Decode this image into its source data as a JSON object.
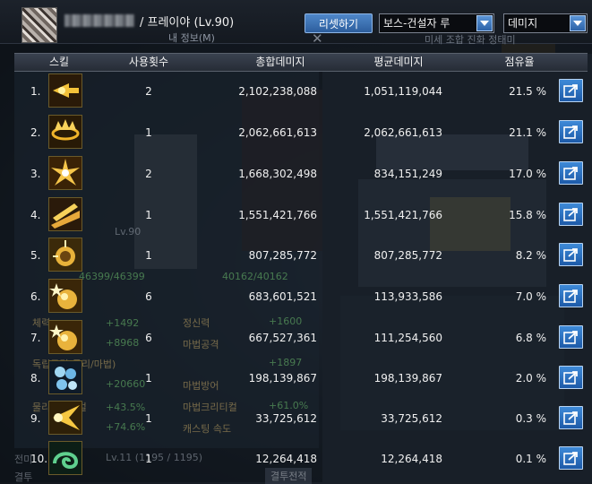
{
  "header": {
    "character_info": "/ 프레이야 (Lv.90)",
    "sub_label": "내 정보(M)",
    "bg_text_right": "미세 조합 진화 정태미",
    "reset_button": "리셋하기",
    "boss_select": "보스-건설자 루",
    "metric_select": "데미지"
  },
  "table": {
    "headers": {
      "skill": "스킬",
      "uses": "사용횟수",
      "total": "총합데미지",
      "avg": "평균데미지",
      "share": "점유율"
    },
    "rows": [
      {
        "rank": "1.",
        "icon": "arrow-skill-icon",
        "uses": "2",
        "total": "2,102,238,088",
        "avg": "1,051,119,044",
        "share": "21.5 %"
      },
      {
        "rank": "2.",
        "icon": "crown-ring-skill-icon",
        "uses": "1",
        "total": "2,062,661,613",
        "avg": "2,062,661,613",
        "share": "21.1 %"
      },
      {
        "rank": "3.",
        "icon": "burst-skill-icon",
        "uses": "2",
        "total": "1,668,302,498",
        "avg": "834,151,249",
        "share": "17.0 %"
      },
      {
        "rank": "4.",
        "icon": "ground-slash-skill-icon",
        "uses": "1",
        "total": "1,551,421,766",
        "avg": "1,551,421,766",
        "share": "15.8 %"
      },
      {
        "rank": "5.",
        "icon": "target-bomb-skill-icon",
        "uses": "1",
        "total": "807,285,772",
        "avg": "807,285,772",
        "share": "8.2 %"
      },
      {
        "rank": "6.",
        "icon": "spark-bomb-skill-icon",
        "uses": "6",
        "total": "683,601,521",
        "avg": "113,933,586",
        "share": "7.0 %"
      },
      {
        "rank": "7.",
        "icon": "spark-bomb-skill-icon",
        "uses": "6",
        "total": "667,527,361",
        "avg": "111,254,560",
        "share": "6.8 %"
      },
      {
        "rank": "8.",
        "icon": "ice-cluster-skill-icon",
        "uses": "1",
        "total": "198,139,867",
        "avg": "198,139,867",
        "share": "2.0 %"
      },
      {
        "rank": "9.",
        "icon": "light-burst-skill-icon",
        "uses": "1",
        "total": "33,725,612",
        "avg": "33,725,612",
        "share": "0.3 %"
      },
      {
        "rank": "10.",
        "icon": "green-spiral-skill-icon",
        "uses": "1",
        "total": "12,264,418",
        "avg": "12,264,418",
        "share": "0.1 %"
      }
    ]
  },
  "background_stats": {
    "lv_text": "Lv.90",
    "hp": "46399/46399",
    "mp": "40162/40162",
    "stat_label_1": "체력",
    "stat_val_1": "+1492",
    "stat_val_2": "+1600",
    "stat_label_2": "정신력",
    "stat_val_3": "+8968",
    "stat_label_3": "마법공격",
    "stat_label_4": "독립공격(물리/마법)",
    "stat_val_4": "+1897",
    "stat_val_5": "+20660",
    "stat_label_5": "마법방어",
    "stat_label_6": "물리크리티컬",
    "stat_val_6": "+43.5%",
    "stat_label_7": "마법크리티컬",
    "stat_val_7": "+61.0%",
    "stat_val_8": "+74.6%",
    "stat_label_8": "캐스팅 속도",
    "bottom_text": "Lv.11 (1195 / 1195)",
    "bottom_button": "결투전적",
    "bottom_label_1": "전미",
    "bottom_label_2": "결투"
  },
  "colors": {
    "accent_blue": "#3e8ad8",
    "header_bg": "#262c36",
    "text": "#f0f0f0"
  }
}
